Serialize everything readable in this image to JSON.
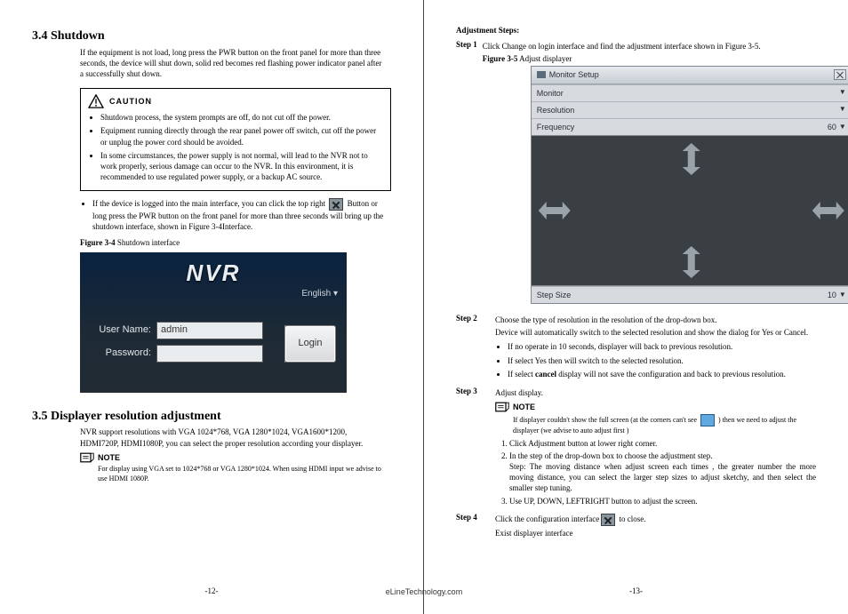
{
  "left": {
    "h_shutdown": "3.4 Shutdown",
    "shutdown_p": "If the equipment is not load, long press the PWR button on the front panel for more than three seconds, the device will shut down, solid red becomes red flashing power indicator panel after a successfully shut down.",
    "caution_label": "CAUTION",
    "caution_items": [
      "Shutdown process, the system prompts are off, do not cut off the power.",
      "Equipment running directly through the rear panel power off switch, cut off the power or unplug the power cord should be avoided.",
      "In some circumstances, the power supply is not normal, will lead to the NVR not to work properly, serious damage can occur to the NVR. In this environment, it is recommended to use regulated power supply, or a backup AC source."
    ],
    "after_caution_pre": "If the device is logged into the main interface, you can click the top right",
    "after_caution_post": "Button or long press the PWR button on the front panel for more than three seconds will bring up the shutdown interface, shown in Figure 3-4Interface.",
    "fig34_b": "Figure 3-4",
    "fig34_t": " Shutdown interface",
    "nvr": {
      "logo": "NVR",
      "lang": "English",
      "user_lbl": "User Name:",
      "user_val": "admin",
      "pass_lbl": "Password:",
      "login": "Login"
    },
    "h_disp": "3.5 Displayer resolution adjustment",
    "disp_p": "NVR support resolutions with VGA 1024*768, VGA 1280*1024, VGA1600*1200, HDMI720P, HDMI1080P, you can select the proper resolution according your displayer.",
    "note_label": "NOTE",
    "note_p": "For display using VGA set to 1024*768 or VGA 1280*1024. When using HDMI input we advise to use HDMI 1080P.",
    "pg": "-12-"
  },
  "right": {
    "adj_h": "Adjustment Steps:",
    "step1_l": "Step 1",
    "step1_t": "Click Change on login interface and find the adjustment interface shown in Figure 3-5.",
    "fig35_b": "Figure 3-5",
    "fig35_t": " Adjust displayer",
    "ms": {
      "title": "Monitor Setup",
      "monitor": "Monitor",
      "resolution": "Resolution",
      "frequency": "Frequency",
      "frequency_v": "60",
      "step": "Step Size",
      "step_v": "10"
    },
    "step2_l": "Step 2",
    "step2_t": "Choose the type of resolution in the resolution of the drop-down box.",
    "step2_p": "Device will automatically switch to the selected resolution and show the dialog for Yes or Cancel.",
    "step2_items": [
      "If no operate in 10 seconds, displayer will back to previous resolution.",
      "If select Yes then will switch to the selected resolution.",
      "If select cancel display will not save the configuration and back to previous resolution."
    ],
    "step3_l": "Step 3",
    "step3_t": "Adjust display.",
    "note_label": "NOTE",
    "note_pre": "If displayer couldn't show the full screen (at the corners can't see",
    "note_post": ") then we need to adjust the displayer (we advise to auto adjust first )",
    "ol": [
      "Click Adjustment button at lower right corner.",
      "In the step of the drop-down box to choose the adjustment step.",
      "Use UP, DOWN, LEFTRIGHT button to adjust the screen."
    ],
    "ol2_extra": "Step: The moving distance when adjust screen each times , the greater number the more moving distance, you can select the larger step sizes to adjust sketchy, and then select the smaller step tuning.",
    "step4_l": "Step 4",
    "step4_pre": "Click the configuration interface",
    "step4_post": " to close.",
    "step4_p2": "Exist displayer interface",
    "pg": "-13-"
  },
  "footer": "eLineTechnology.com"
}
